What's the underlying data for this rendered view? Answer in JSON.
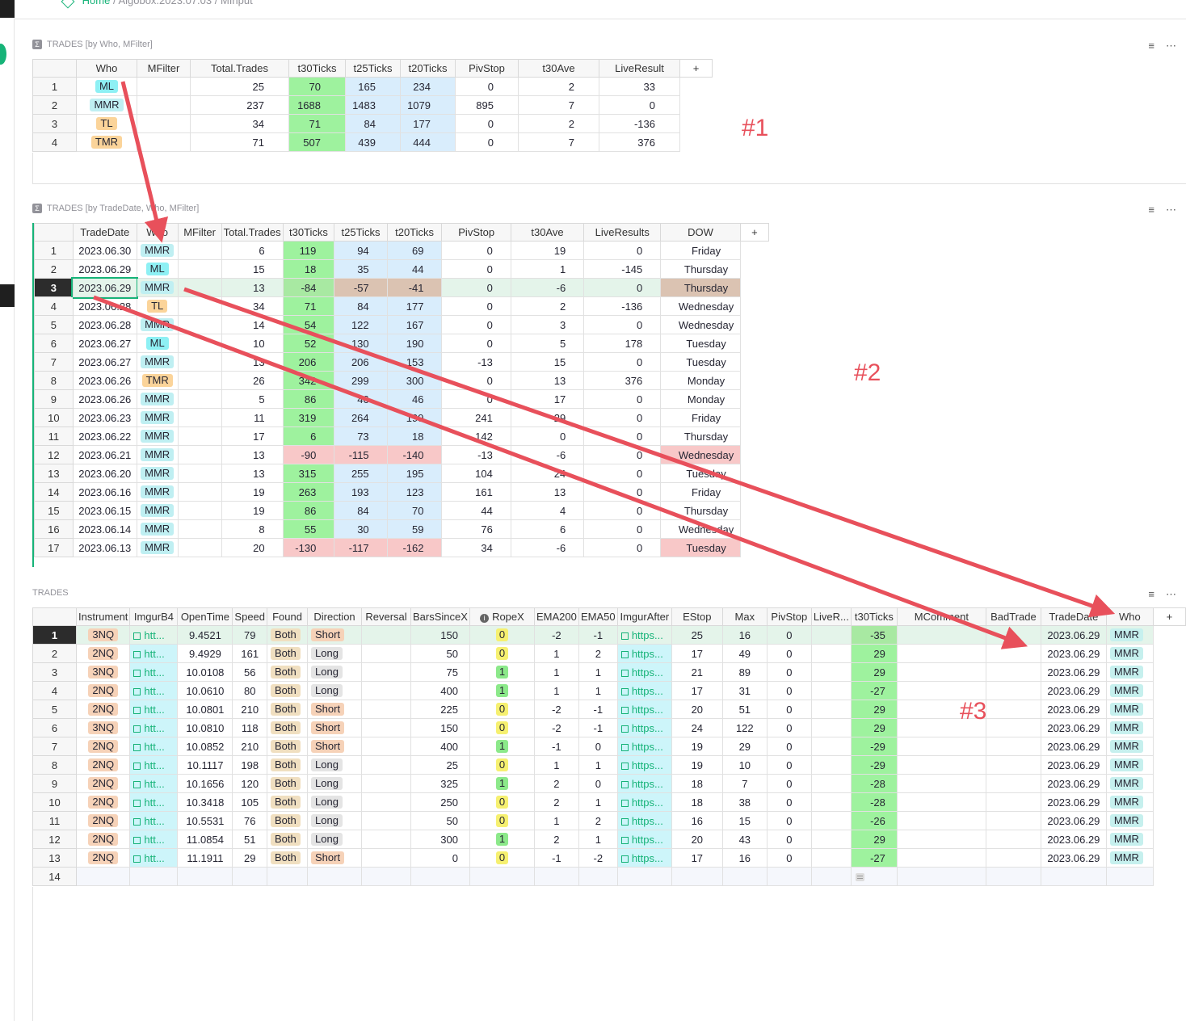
{
  "breadcrumb": {
    "home": "Home",
    "doc": "Algobox.2023.07.03",
    "page": "MInput"
  },
  "icons": [
    "sort-filter-icon",
    "more-icon",
    "sigma-icon",
    "external-link-icon",
    "info-icon",
    "cell-menu-icon"
  ],
  "colors": {
    "accent": "#16b378",
    "annotation": "#e8505b",
    "green": "#9ef29e",
    "blue": "#d9edfc",
    "pink": "#f8c8c8"
  },
  "annotations": {
    "a1": "#1",
    "a2": "#2",
    "a3": "#3"
  },
  "table1": {
    "title": "TRADES [by Who, MFilter]",
    "columns": [
      "Who",
      "MFilter",
      "Total.Trades",
      "t30Ticks",
      "t25Ticks",
      "t20Ticks",
      "PivStop",
      "t30Ave",
      "LiveResult",
      "+"
    ],
    "rows": [
      {
        "n": "1",
        "who": "ML",
        "mfilter": "",
        "total": "25",
        "t30": "70",
        "t25": "165",
        "t20": "234",
        "piv": "0",
        "ave": "2",
        "live": "33"
      },
      {
        "n": "2",
        "who": "MMR",
        "mfilter": "",
        "total": "237",
        "t30": "1688",
        "t25": "1483",
        "t20": "1079",
        "piv": "895",
        "ave": "7",
        "live": "0"
      },
      {
        "n": "3",
        "who": "TL",
        "mfilter": "",
        "total": "34",
        "t30": "71",
        "t25": "84",
        "t20": "177",
        "piv": "0",
        "ave": "2",
        "live": "-136"
      },
      {
        "n": "4",
        "who": "TMR",
        "mfilter": "",
        "total": "71",
        "t30": "507",
        "t25": "439",
        "t20": "444",
        "piv": "0",
        "ave": "7",
        "live": "376"
      }
    ]
  },
  "table2": {
    "title": "TRADES [by TradeDate, Who, MFilter]",
    "columns": [
      "TradeDate",
      "Who",
      "MFilter",
      "Total.Trades",
      "t30Ticks",
      "t25Ticks",
      "t20Ticks",
      "PivStop",
      "t30Ave",
      "LiveResults",
      "DOW",
      "+"
    ],
    "rows": [
      {
        "n": "1",
        "date": "2023.06.30",
        "who": "MMR",
        "total": "6",
        "t30": "119",
        "t25": "94",
        "t20": "69",
        "piv": "0",
        "ave": "19",
        "live": "0",
        "dow": "Friday"
      },
      {
        "n": "2",
        "date": "2023.06.29",
        "who": "ML",
        "total": "15",
        "t30": "18",
        "t25": "35",
        "t20": "44",
        "piv": "0",
        "ave": "1",
        "live": "-145",
        "dow": "Thursday"
      },
      {
        "n": "3",
        "date": "2023.06.29",
        "who": "MMR",
        "total": "13",
        "t30": "-84",
        "t25": "-57",
        "t20": "-41",
        "piv": "0",
        "ave": "-6",
        "live": "0",
        "dow": "Thursday"
      },
      {
        "n": "4",
        "date": "2023.06.28",
        "who": "TL",
        "total": "34",
        "t30": "71",
        "t25": "84",
        "t20": "177",
        "piv": "0",
        "ave": "2",
        "live": "-136",
        "dow": "Wednesday"
      },
      {
        "n": "5",
        "date": "2023.06.28",
        "who": "MMR",
        "total": "14",
        "t30": "54",
        "t25": "122",
        "t20": "167",
        "piv": "0",
        "ave": "3",
        "live": "0",
        "dow": "Wednesday"
      },
      {
        "n": "6",
        "date": "2023.06.27",
        "who": "ML",
        "total": "10",
        "t30": "52",
        "t25": "130",
        "t20": "190",
        "piv": "0",
        "ave": "5",
        "live": "178",
        "dow": "Tuesday"
      },
      {
        "n": "7",
        "date": "2023.06.27",
        "who": "MMR",
        "total": "13",
        "t30": "206",
        "t25": "206",
        "t20": "153",
        "piv": "-13",
        "ave": "15",
        "live": "0",
        "dow": "Tuesday"
      },
      {
        "n": "8",
        "date": "2023.06.26",
        "who": "TMR",
        "total": "26",
        "t30": "342",
        "t25": "299",
        "t20": "300",
        "piv": "0",
        "ave": "13",
        "live": "376",
        "dow": "Monday"
      },
      {
        "n": "9",
        "date": "2023.06.26",
        "who": "MMR",
        "total": "5",
        "t30": "86",
        "t25": "46",
        "t20": "46",
        "piv": "0",
        "ave": "17",
        "live": "0",
        "dow": "Monday"
      },
      {
        "n": "10",
        "date": "2023.06.23",
        "who": "MMR",
        "total": "11",
        "t30": "319",
        "t25": "264",
        "t20": "199",
        "piv": "241",
        "ave": "29",
        "live": "0",
        "dow": "Friday"
      },
      {
        "n": "11",
        "date": "2023.06.22",
        "who": "MMR",
        "total": "17",
        "t30": "6",
        "t25": "73",
        "t20": "18",
        "piv": "142",
        "ave": "0",
        "live": "0",
        "dow": "Thursday"
      },
      {
        "n": "12",
        "date": "2023.06.21",
        "who": "MMR",
        "total": "13",
        "t30": "-90",
        "t25": "-115",
        "t20": "-140",
        "piv": "-13",
        "ave": "-6",
        "live": "0",
        "dow": "Wednesday"
      },
      {
        "n": "13",
        "date": "2023.06.20",
        "who": "MMR",
        "total": "13",
        "t30": "315",
        "t25": "255",
        "t20": "195",
        "piv": "104",
        "ave": "24",
        "live": "0",
        "dow": "Tuesday"
      },
      {
        "n": "14",
        "date": "2023.06.16",
        "who": "MMR",
        "total": "19",
        "t30": "263",
        "t25": "193",
        "t20": "123",
        "piv": "161",
        "ave": "13",
        "live": "0",
        "dow": "Friday"
      },
      {
        "n": "15",
        "date": "2023.06.15",
        "who": "MMR",
        "total": "19",
        "t30": "86",
        "t25": "84",
        "t20": "70",
        "piv": "44",
        "ave": "4",
        "live": "0",
        "dow": "Thursday"
      },
      {
        "n": "16",
        "date": "2023.06.14",
        "who": "MMR",
        "total": "8",
        "t30": "55",
        "t25": "30",
        "t20": "59",
        "piv": "76",
        "ave": "6",
        "live": "0",
        "dow": "Wednesday"
      },
      {
        "n": "17",
        "date": "2023.06.13",
        "who": "MMR",
        "total": "20",
        "t30": "-130",
        "t25": "-117",
        "t20": "-162",
        "piv": "34",
        "ave": "-6",
        "live": "0",
        "dow": "Tuesday"
      }
    ]
  },
  "table3": {
    "title": "TRADES",
    "columns": [
      "Instrument",
      "ImgurB4",
      "OpenTime",
      "Speed",
      "Found",
      "Direction",
      "Reversal",
      "BarsSinceX",
      "RopeX",
      "EMA200",
      "EMA50",
      "ImgurAfter",
      "EStop",
      "Max",
      "PivStop",
      "LiveR...",
      "t30Ticks",
      "MComment",
      "BadTrade",
      "TradeDate",
      "Who",
      "+"
    ],
    "rows": [
      {
        "n": "1",
        "inst": "3NQ",
        "b4": "htt...",
        "open": "9.4521",
        "speed": "79",
        "found": "Both",
        "dir": "Short",
        "rev": "",
        "bars": "150",
        "rope": "0",
        "e200": "-2",
        "e50": "-1",
        "after": "https...",
        "estop": "25",
        "max": "16",
        "piv": "0",
        "live": "",
        "t30": "-35",
        "mc": "",
        "bad": "",
        "date": "2023.06.29",
        "who": "MMR"
      },
      {
        "n": "2",
        "inst": "2NQ",
        "b4": "htt...",
        "open": "9.4929",
        "speed": "161",
        "found": "Both",
        "dir": "Long",
        "rev": "",
        "bars": "50",
        "rope": "0",
        "e200": "1",
        "e50": "2",
        "after": "https...",
        "estop": "17",
        "max": "49",
        "piv": "0",
        "live": "",
        "t30": "29",
        "mc": "",
        "bad": "",
        "date": "2023.06.29",
        "who": "MMR"
      },
      {
        "n": "3",
        "inst": "3NQ",
        "b4": "htt...",
        "open": "10.0108",
        "speed": "56",
        "found": "Both",
        "dir": "Long",
        "rev": "",
        "bars": "75",
        "rope": "1",
        "e200": "1",
        "e50": "1",
        "after": "https...",
        "estop": "21",
        "max": "89",
        "piv": "0",
        "live": "",
        "t30": "29",
        "mc": "",
        "bad": "",
        "date": "2023.06.29",
        "who": "MMR"
      },
      {
        "n": "4",
        "inst": "2NQ",
        "b4": "htt...",
        "open": "10.0610",
        "speed": "80",
        "found": "Both",
        "dir": "Long",
        "rev": "",
        "bars": "400",
        "rope": "1",
        "e200": "1",
        "e50": "1",
        "after": "https...",
        "estop": "17",
        "max": "31",
        "piv": "0",
        "live": "",
        "t30": "-27",
        "mc": "",
        "bad": "",
        "date": "2023.06.29",
        "who": "MMR"
      },
      {
        "n": "5",
        "inst": "2NQ",
        "b4": "htt...",
        "open": "10.0801",
        "speed": "210",
        "found": "Both",
        "dir": "Short",
        "rev": "",
        "bars": "225",
        "rope": "0",
        "e200": "-2",
        "e50": "-1",
        "after": "https...",
        "estop": "20",
        "max": "51",
        "piv": "0",
        "live": "",
        "t30": "29",
        "mc": "",
        "bad": "",
        "date": "2023.06.29",
        "who": "MMR"
      },
      {
        "n": "6",
        "inst": "3NQ",
        "b4": "htt...",
        "open": "10.0810",
        "speed": "118",
        "found": "Both",
        "dir": "Short",
        "rev": "",
        "bars": "150",
        "rope": "0",
        "e200": "-2",
        "e50": "-1",
        "after": "https...",
        "estop": "24",
        "max": "122",
        "piv": "0",
        "live": "",
        "t30": "29",
        "mc": "",
        "bad": "",
        "date": "2023.06.29",
        "who": "MMR"
      },
      {
        "n": "7",
        "inst": "2NQ",
        "b4": "htt...",
        "open": "10.0852",
        "speed": "210",
        "found": "Both",
        "dir": "Short",
        "rev": "",
        "bars": "400",
        "rope": "1",
        "e200": "-1",
        "e50": "0",
        "after": "https...",
        "estop": "19",
        "max": "29",
        "piv": "0",
        "live": "",
        "t30": "-29",
        "mc": "",
        "bad": "",
        "date": "2023.06.29",
        "who": "MMR"
      },
      {
        "n": "8",
        "inst": "2NQ",
        "b4": "htt...",
        "open": "10.1117",
        "speed": "198",
        "found": "Both",
        "dir": "Long",
        "rev": "",
        "bars": "25",
        "rope": "0",
        "e200": "1",
        "e50": "1",
        "after": "https...",
        "estop": "19",
        "max": "10",
        "piv": "0",
        "live": "",
        "t30": "-29",
        "mc": "",
        "bad": "",
        "date": "2023.06.29",
        "who": "MMR"
      },
      {
        "n": "9",
        "inst": "2NQ",
        "b4": "htt...",
        "open": "10.1656",
        "speed": "120",
        "found": "Both",
        "dir": "Long",
        "rev": "",
        "bars": "325",
        "rope": "1",
        "e200": "2",
        "e50": "0",
        "after": "https...",
        "estop": "18",
        "max": "7",
        "piv": "0",
        "live": "",
        "t30": "-28",
        "mc": "",
        "bad": "",
        "date": "2023.06.29",
        "who": "MMR"
      },
      {
        "n": "10",
        "inst": "2NQ",
        "b4": "htt...",
        "open": "10.3418",
        "speed": "105",
        "found": "Both",
        "dir": "Long",
        "rev": "",
        "bars": "250",
        "rope": "0",
        "e200": "2",
        "e50": "1",
        "after": "https...",
        "estop": "18",
        "max": "38",
        "piv": "0",
        "live": "",
        "t30": "-28",
        "mc": "",
        "bad": "",
        "date": "2023.06.29",
        "who": "MMR"
      },
      {
        "n": "11",
        "inst": "2NQ",
        "b4": "htt...",
        "open": "10.5531",
        "speed": "76",
        "found": "Both",
        "dir": "Long",
        "rev": "",
        "bars": "50",
        "rope": "0",
        "e200": "1",
        "e50": "2",
        "after": "https...",
        "estop": "16",
        "max": "15",
        "piv": "0",
        "live": "",
        "t30": "-26",
        "mc": "",
        "bad": "",
        "date": "2023.06.29",
        "who": "MMR"
      },
      {
        "n": "12",
        "inst": "2NQ",
        "b4": "htt...",
        "open": "11.0854",
        "speed": "51",
        "found": "Both",
        "dir": "Long",
        "rev": "",
        "bars": "300",
        "rope": "1",
        "e200": "2",
        "e50": "1",
        "after": "https...",
        "estop": "20",
        "max": "43",
        "piv": "0",
        "live": "",
        "t30": "29",
        "mc": "",
        "bad": "",
        "date": "2023.06.29",
        "who": "MMR"
      },
      {
        "n": "13",
        "inst": "2NQ",
        "b4": "htt...",
        "open": "11.1911",
        "speed": "29",
        "found": "Both",
        "dir": "Short",
        "rev": "",
        "bars": "0",
        "rope": "0",
        "e200": "-1",
        "e50": "-2",
        "after": "https...",
        "estop": "17",
        "max": "16",
        "piv": "0",
        "live": "",
        "t30": "-27",
        "mc": "",
        "bad": "",
        "date": "2023.06.29",
        "who": "MMR"
      }
    ],
    "new_row": "14"
  }
}
